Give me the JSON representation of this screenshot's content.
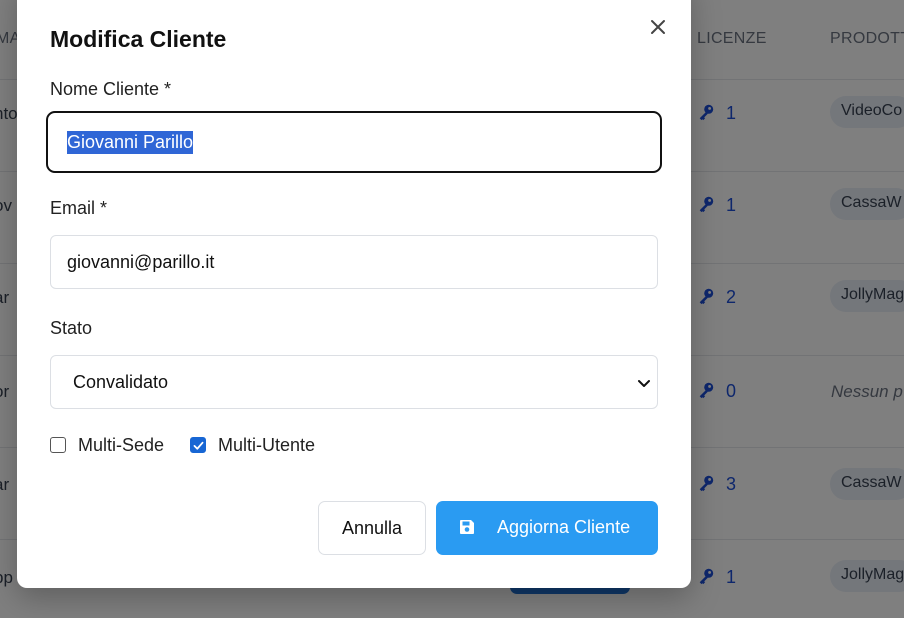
{
  "background_table": {
    "columns": {
      "left_fragment": "MA",
      "licenses": "LICENZE",
      "products": "PRODOTT"
    },
    "rows": [
      {
        "left_fragment": "nto",
        "licenses": "1",
        "product": "VideoCo"
      },
      {
        "left_fragment": "ov",
        "licenses": "1",
        "product": "CassaW"
      },
      {
        "left_fragment": "ar",
        "licenses": "2",
        "product": "JollyMag"
      },
      {
        "left_fragment": "or",
        "licenses": "0",
        "product": "Nessun p"
      },
      {
        "left_fragment": "ar",
        "licenses": "3",
        "product": "CassaW"
      },
      {
        "left_fragment": "pp",
        "licenses": "1",
        "product": "JollyMag"
      }
    ]
  },
  "modal": {
    "title": "Modifica Cliente",
    "name_label": "Nome Cliente *",
    "name_value": "Giovanni Parillo",
    "email_label": "Email *",
    "email_value": "giovanni@parillo.it",
    "status_label": "Stato",
    "status_value": "Convalidato",
    "multi_sede_label": "Multi-Sede",
    "multi_sede_checked": false,
    "multi_utente_label": "Multi-Utente",
    "multi_utente_checked": true,
    "cancel_label": "Annulla",
    "submit_label": "Aggiorna Cliente"
  },
  "colors": {
    "primary": "#2a9bf2",
    "checkbox": "#1766d4",
    "selection": "#2f66d6",
    "license_text": "#1d4ed8"
  },
  "icons": [
    "close-icon",
    "save-icon",
    "chevron-down-icon",
    "key-icon",
    "check-icon"
  ]
}
